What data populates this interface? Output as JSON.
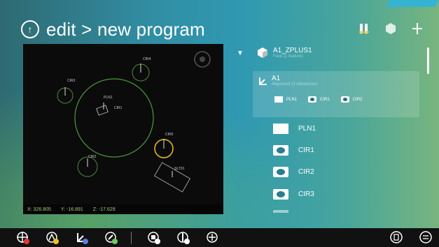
{
  "header": {
    "title": "edit > new program"
  },
  "viewport": {
    "coords": {
      "x": "X: 326.805",
      "y": "Y: -16.891",
      "z": "Z: -17.629"
    },
    "features": [
      {
        "name": "CIR3"
      },
      {
        "name": "CIR4"
      },
      {
        "name": "PLN1"
      },
      {
        "name": "CIR1"
      },
      {
        "name": "CIR5"
      },
      {
        "name": "CIR2"
      },
      {
        "name": "SLT01"
      }
    ]
  },
  "tree": {
    "part": {
      "name": "A1_ZPLUS1",
      "sub": "Face (1 feature)"
    },
    "alignment": {
      "name": "A1",
      "sub": "Alignment (3 references)",
      "refs": [
        {
          "label": "PLN1"
        },
        {
          "label": "CIR1"
        },
        {
          "label": "CIR2"
        }
      ]
    },
    "items": [
      {
        "label": "PLN1",
        "type": "plane"
      },
      {
        "label": "CIR1",
        "type": "circle"
      },
      {
        "label": "CIR2",
        "type": "circle"
      },
      {
        "label": "CIR3",
        "type": "circle"
      }
    ]
  },
  "colors": {
    "accent_blue": "#34b4d2",
    "viewport_bg": "#0b0b0b",
    "highlight_yellow": "#f0c020",
    "feature_green": "#5fa84a"
  }
}
